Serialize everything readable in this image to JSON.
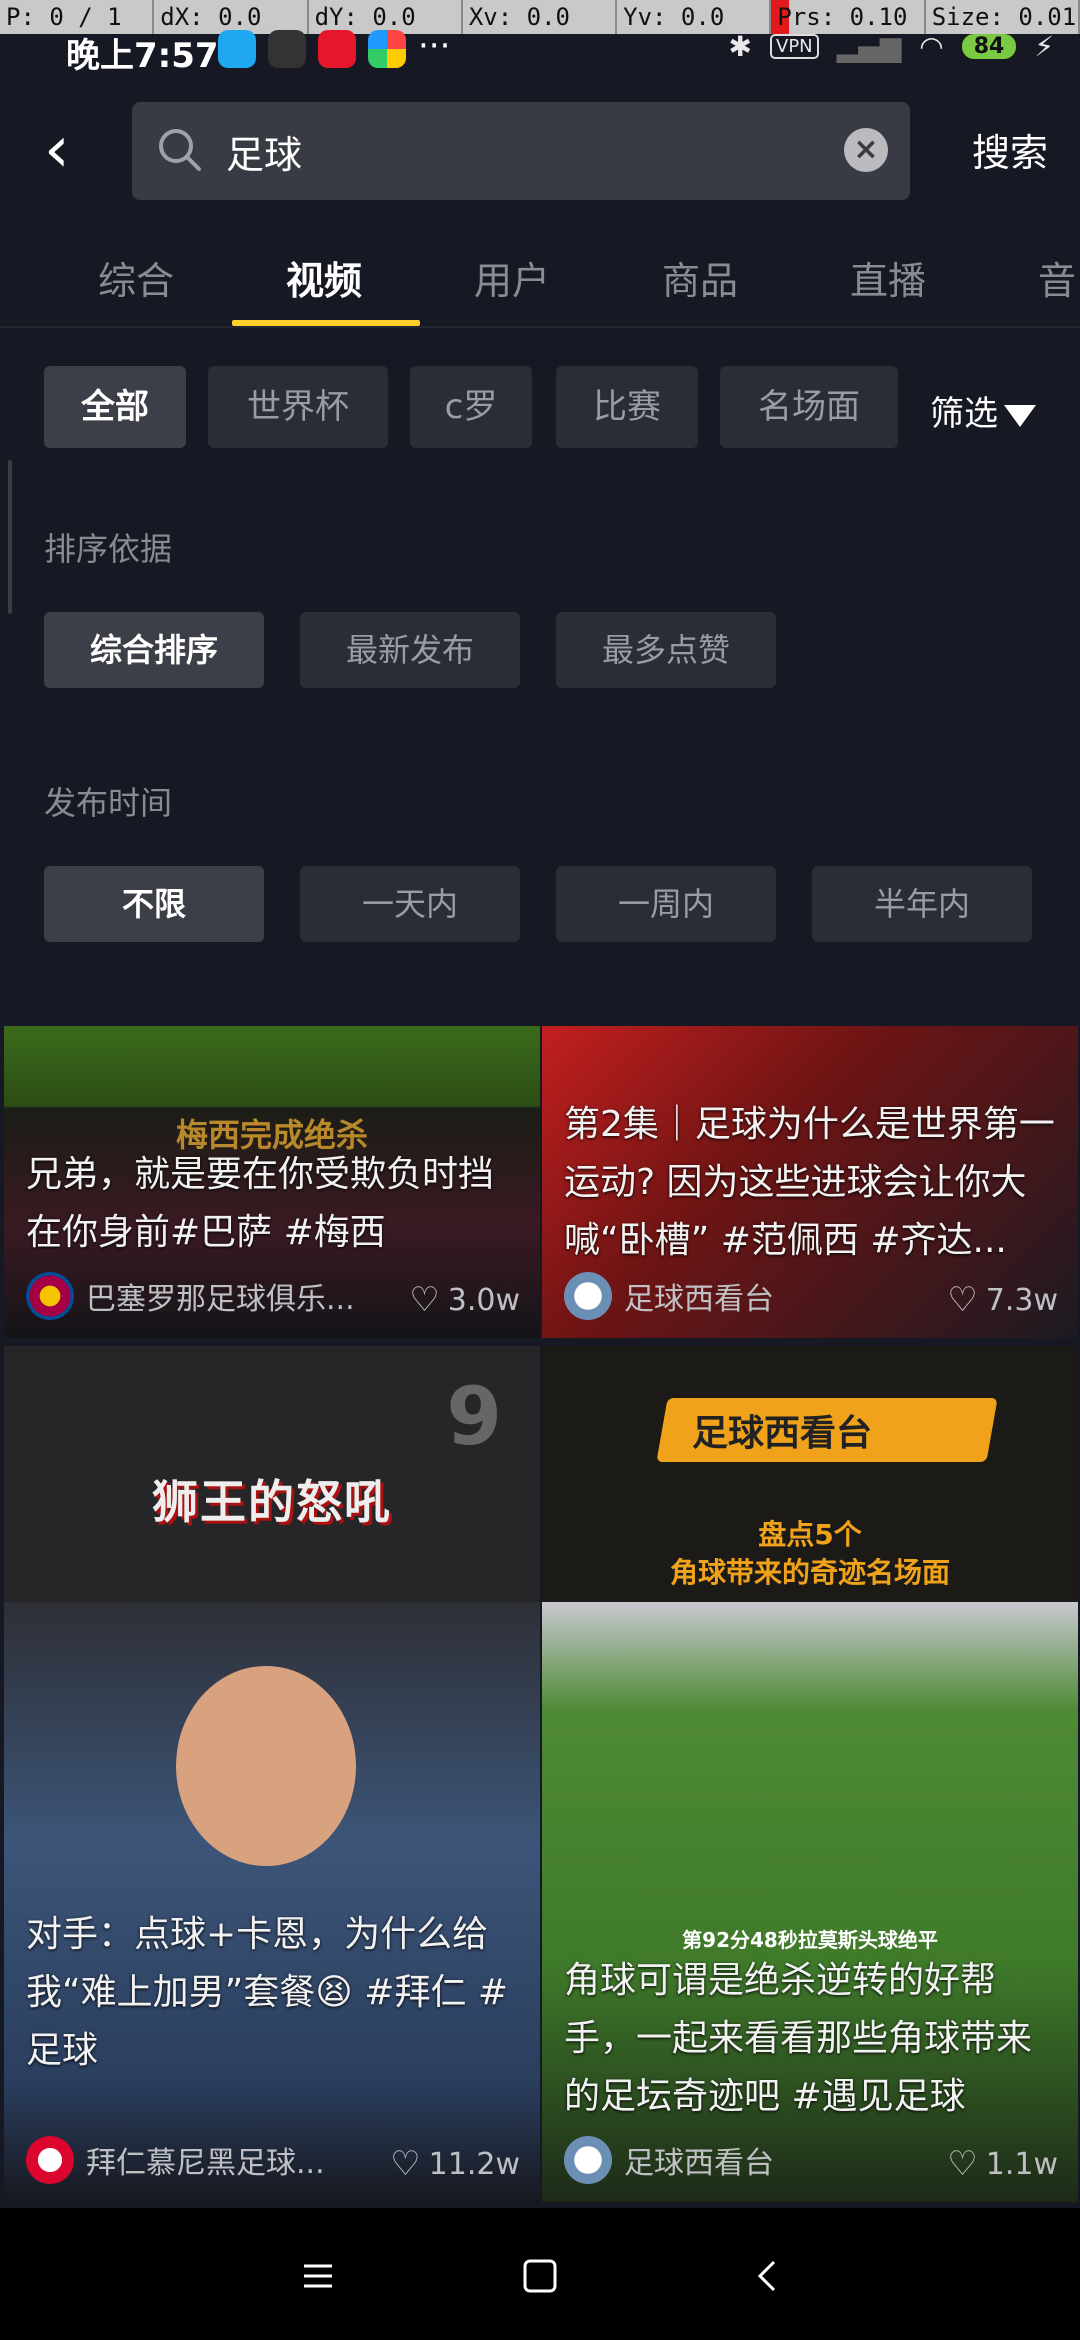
{
  "dev_overlay": {
    "p": "P: 0 / 1",
    "dx": "dX: 0.0",
    "dy": "dY: 0.0",
    "xv": "Xv: 0.0",
    "yv": "Yv: 0.0",
    "prs": "Prs: 0.10",
    "size": "Size: 0.01"
  },
  "status_bar": {
    "time": "晚上7:57",
    "vpn": "VPN",
    "battery": "84"
  },
  "search": {
    "query": "足球",
    "button_label": "搜索"
  },
  "tabs": [
    "综合",
    "视频",
    "用户",
    "商品",
    "直播",
    "音"
  ],
  "active_tab": "视频",
  "filter_chips": [
    "全部",
    "世界杯",
    "c罗",
    "比赛",
    "名场面"
  ],
  "filter_button": "筛选",
  "sort": {
    "label": "排序依据",
    "options": [
      "综合排序",
      "最新发布",
      "最多点赞"
    ]
  },
  "publish_time": {
    "label": "发布时间",
    "options": [
      "不限",
      "一天内",
      "一周内",
      "半年内"
    ]
  },
  "videos": [
    {
      "overlay_text": "梅西完成绝杀",
      "title": "兄弟，就是要在你受欺负时挡在你身前#巴萨 #梅西",
      "author": "巴塞罗那足球俱乐...",
      "likes": "3.0w"
    },
    {
      "overlay_text": "",
      "title": "第2集｜足球为什么是世界第一运动? 因为这些进球会让你大喊“卧槽” #范佩西 #齐达...",
      "author": "足球西看台",
      "likes": "7.3w"
    },
    {
      "overlay_text": "狮王的怒吼",
      "title": "对手：点球+卡恩，为什么给我“难上加男”套餐😫 #拜仁 #足球",
      "author": "拜仁慕尼黑足球...",
      "likes": "11.2w"
    },
    {
      "overlay_text": "足球西看台",
      "overlay_sub": "盘点5个\n角球带来的奇迹名场面",
      "caption": "第92分48秒拉莫斯头球绝平",
      "title": "角球可谓是绝杀逆转的好帮手，一起来看看那些角球带来的足坛奇迹吧 #遇见足球",
      "author": "足球西看台",
      "likes": "1.1w"
    }
  ],
  "colors": {
    "accent": "#fcd22a",
    "background": "#161823",
    "chip": "#2b2d36"
  }
}
